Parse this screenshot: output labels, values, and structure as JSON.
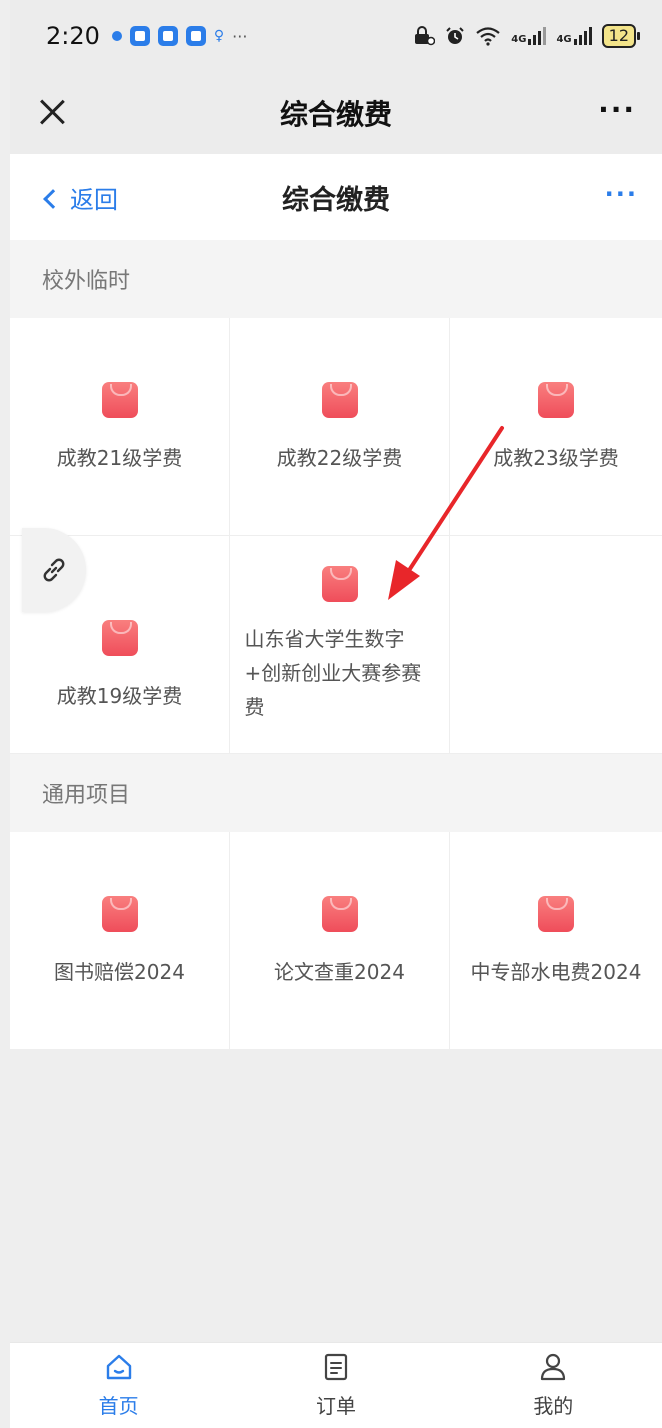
{
  "status_bar": {
    "time": "2:20",
    "more": "···",
    "network1": "4G",
    "network2": "4G",
    "battery": "12"
  },
  "title_bar": {
    "title": "综合缴费",
    "more": "···"
  },
  "nav_bar": {
    "back_label": "返回",
    "title": "综合缴费",
    "more": "···"
  },
  "sections": [
    {
      "title": "校外临时",
      "items": [
        {
          "label": "成教21级学费",
          "icon": "shopping-bag-icon"
        },
        {
          "label": "成教22级学费",
          "icon": "shopping-bag-icon"
        },
        {
          "label": "成教23级学费",
          "icon": "shopping-bag-icon"
        },
        {
          "label": "成教19级学费",
          "icon": "shopping-bag-icon"
        },
        {
          "label": "山东省大学生数字+创新创业大赛参赛费",
          "icon": "shopping-bag-icon"
        }
      ]
    },
    {
      "title": "通用项目",
      "items": [
        {
          "label": "图书赔偿2024",
          "icon": "shopping-bag-icon"
        },
        {
          "label": "论文查重2024",
          "icon": "shopping-bag-icon"
        },
        {
          "label": "中专部水电费2024",
          "icon": "shopping-bag-icon"
        }
      ]
    }
  ],
  "tab_bar": {
    "tabs": [
      {
        "label": "首页",
        "icon": "home-icon",
        "active": true
      },
      {
        "label": "订单",
        "icon": "document-icon",
        "active": false
      },
      {
        "label": "我的",
        "icon": "user-icon",
        "active": false
      }
    ]
  },
  "colors": {
    "accent": "#2b7de9",
    "bag_top": "#f97f7f",
    "bag_bottom": "#ef4d5a",
    "arrow": "#e8262a"
  }
}
